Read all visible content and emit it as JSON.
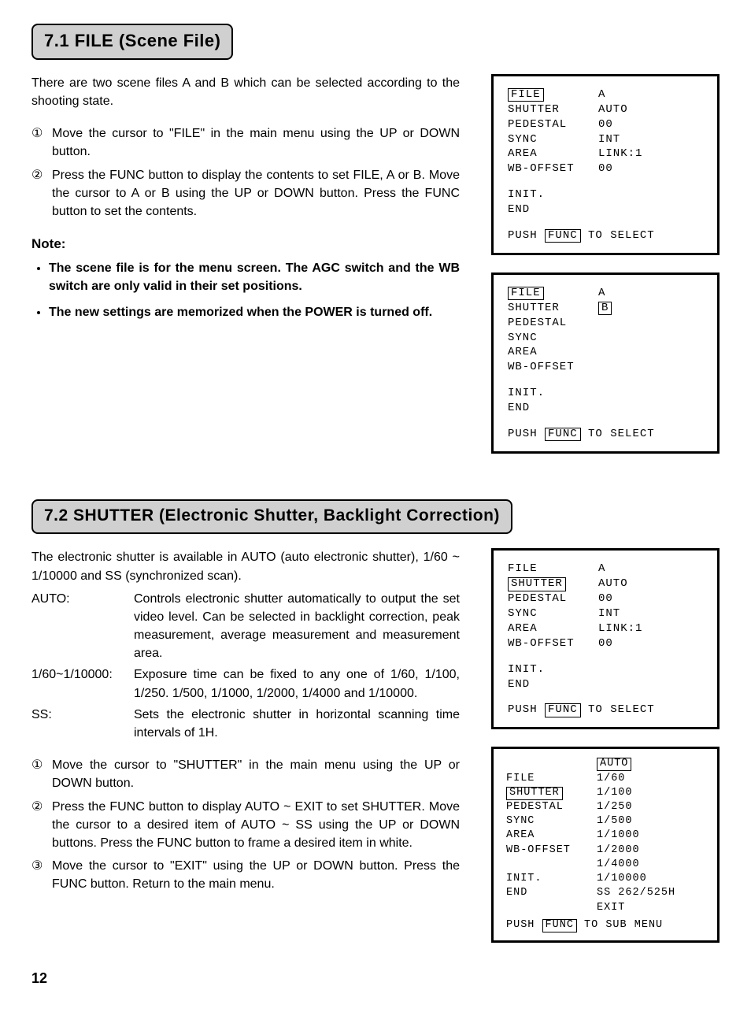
{
  "page_number": "12",
  "section1": {
    "header": "7.1 FILE (Scene File)",
    "intro": "There are two scene files A and B which can be selected according to the shooting state.",
    "steps": [
      "Move the cursor to \"FILE\" in the main menu using the UP or DOWN button.",
      "Press the FUNC button to display the contents to set FILE, A or B. Move the cursor to A or B using the UP or DOWN button. Press the FUNC button to set the contents."
    ],
    "note_heading": "Note:",
    "notes": [
      "The scene file is for the menu screen. The AGC switch and the WB switch are only valid in their set positions.",
      "The new settings are memorized when the POWER is turned off."
    ],
    "menu1": {
      "rows": [
        {
          "label": "FILE",
          "value": "A",
          "label_boxed": true
        },
        {
          "label": "SHUTTER",
          "value": "AUTO"
        },
        {
          "label": "PEDESTAL",
          "value": "00"
        },
        {
          "label": "SYNC",
          "value": "INT"
        },
        {
          "label": "AREA",
          "value": "LINK:1"
        },
        {
          "label": "WB-OFFSET",
          "value": "00"
        }
      ],
      "tail": [
        "INIT.",
        "END"
      ],
      "push_pre": "PUSH",
      "push_box": "FUNC",
      "push_post": "TO SELECT"
    },
    "menu2": {
      "rows": [
        {
          "label": "FILE",
          "value": "A",
          "label_boxed": true
        },
        {
          "label": "SHUTTER",
          "value": "B",
          "value_boxed": true
        },
        {
          "label": "PEDESTAL",
          "value": ""
        },
        {
          "label": "SYNC",
          "value": ""
        },
        {
          "label": "AREA",
          "value": ""
        },
        {
          "label": "WB-OFFSET",
          "value": ""
        }
      ],
      "tail": [
        "INIT.",
        "END"
      ],
      "push_pre": "PUSH",
      "push_box": "FUNC",
      "push_post": "TO SELECT"
    }
  },
  "section2": {
    "header": "7.2 SHUTTER (Electronic Shutter, Backlight Correction)",
    "intro": "The electronic shutter is available in AUTO (auto electronic shutter), 1/60 ~ 1/10000 and SS (synchronized scan).",
    "defs": [
      {
        "term": "AUTO:",
        "body": "Controls electronic shutter automatically to output the set video level. Can be selected in backlight correction, peak measurement, average measurement and measurement area."
      },
      {
        "term": "1/60~1/10000:",
        "body": "Exposure time can be fixed to any one of 1/60, 1/100, 1/250. 1/500, 1/1000, 1/2000, 1/4000 and 1/10000."
      },
      {
        "term": "SS:",
        "body": "Sets the electronic shutter in horizontal scanning time intervals of 1H."
      }
    ],
    "steps": [
      "Move the cursor to \"SHUTTER\" in the main menu using the UP or DOWN button.",
      "Press the FUNC button to display AUTO ~ EXIT to set SHUTTER. Move the cursor to a desired item of AUTO ~ SS using the UP or DOWN buttons. Press the FUNC button to frame a desired item in white.",
      "Move the cursor to \"EXIT\" using the UP or DOWN button. Press the FUNC button. Return to the main menu."
    ],
    "menu1": {
      "rows": [
        {
          "label": "FILE",
          "value": "A"
        },
        {
          "label": "SHUTTER",
          "value": "AUTO",
          "label_boxed": true
        },
        {
          "label": "PEDESTAL",
          "value": "00"
        },
        {
          "label": "SYNC",
          "value": "INT"
        },
        {
          "label": "AREA",
          "value": "LINK:1"
        },
        {
          "label": "WB-OFFSET",
          "value": "00"
        }
      ],
      "tail": [
        "INIT.",
        "END"
      ],
      "push_pre": "PUSH",
      "push_box": "FUNC",
      "push_post": "TO SELECT"
    },
    "menu2": {
      "rows": [
        {
          "label": "",
          "value": "AUTO",
          "value_boxed": true
        },
        {
          "label": "FILE",
          "value": "1/60"
        },
        {
          "label": "SHUTTER",
          "value": "1/100",
          "label_boxed": true
        },
        {
          "label": "PEDESTAL",
          "value": "1/250"
        },
        {
          "label": "SYNC",
          "value": "1/500"
        },
        {
          "label": "AREA",
          "value": "1/1000"
        },
        {
          "label": "WB-OFFSET",
          "value": "1/2000"
        },
        {
          "label": "",
          "value": "1/4000"
        },
        {
          "label": "INIT.",
          "value": "1/10000"
        },
        {
          "label": "END",
          "value": "SS 262/525H"
        },
        {
          "label": "",
          "value": "EXIT"
        }
      ],
      "push_pre": "PUSH",
      "push_box": "FUNC",
      "push_post": "TO SUB MENU"
    }
  },
  "circled": [
    "①",
    "②",
    "③"
  ]
}
